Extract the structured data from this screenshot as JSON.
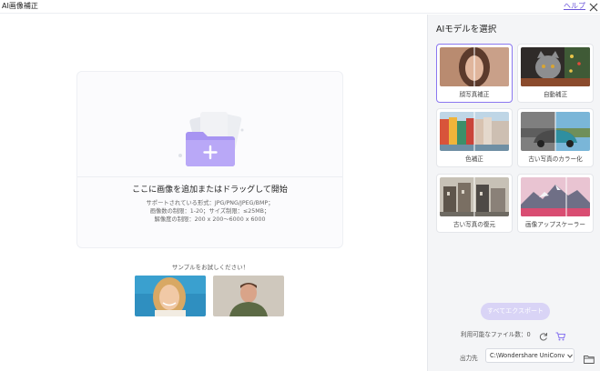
{
  "titlebar": {
    "title": "AI画像補正",
    "help": "ヘルプ"
  },
  "dropzone": {
    "title": "ここに画像を追加またはドラッグして開始",
    "info": [
      "サポートされている形式：JPG/PNG/JPEG/BMP；",
      "画像数の制限：1-20；サイズ制限：≤25MB；",
      "解像度の制限：200 x 200～6000 x 6000"
    ]
  },
  "samples": {
    "title": "サンプルをお試しください！"
  },
  "sidebar": {
    "title": "AIモデルを選択",
    "models": [
      {
        "label": "顔写真補正"
      },
      {
        "label": "自動補正"
      },
      {
        "label": "色補正"
      },
      {
        "label": "古い写真のカラー化"
      },
      {
        "label": "古い写真の復元"
      },
      {
        "label": "画像アップスケーラー"
      }
    ],
    "export_label": "すべてエクスポート",
    "file_count": "利用可能なファイル数：0",
    "output_label": "出力先",
    "output_path": "C:\\Wondershare UniConv"
  },
  "colors": {
    "accent": "#8b78f0",
    "export_disabled": "#d9d4f6",
    "help_link": "#6b55d9"
  }
}
